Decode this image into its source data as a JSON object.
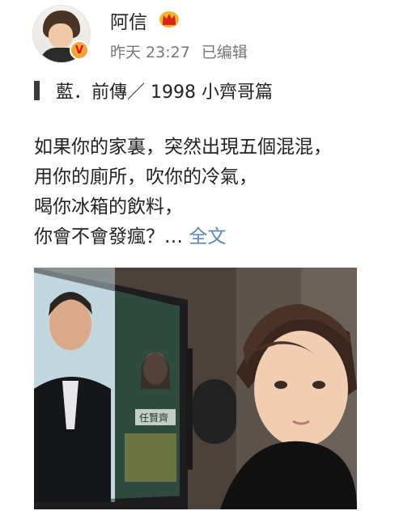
{
  "post": {
    "author": "阿信",
    "timestamp": "昨天 23:27",
    "edited": "已编辑",
    "verified_mark": "V",
    "title": "藍．前傳／ 1998 小齊哥篇",
    "lines": [
      "如果你的家裏，突然出現五個混混，",
      "用你的廁所，吹你的冷氣，",
      "喝你冰箱的飲料，",
      "你會不會發瘋？…"
    ],
    "full_text_link": "全文",
    "photo_poster_text": "任賢齊"
  },
  "colors": {
    "link": "#5b86b7",
    "meta": "#777777",
    "badge": "#f2a53a",
    "badge_v": "#d4131b"
  }
}
